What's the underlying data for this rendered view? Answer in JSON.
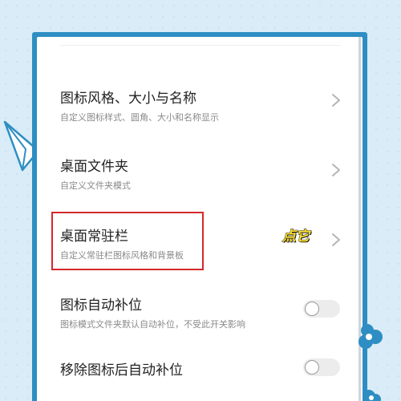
{
  "settings": {
    "items": [
      {
        "title": "图标风格、大小与名称",
        "subtitle": "自定义图标样式、圆角、大小和名称显示",
        "control": "chevron"
      },
      {
        "title": "桌面文件夹",
        "subtitle": "自定义文件夹模式",
        "control": "chevron"
      },
      {
        "title": "桌面常驻栏",
        "subtitle": "自定义常驻栏图标风格和背景板",
        "control": "chevron"
      },
      {
        "title": "图标自动补位",
        "subtitle": "图标模式文件夹默认自动补位，不受此开关影响",
        "control": "toggle",
        "toggle_on": false
      },
      {
        "title": "移除图标后自动补位",
        "subtitle": "",
        "control": "toggle",
        "toggle_on": false
      }
    ]
  },
  "annotation": {
    "label": "点它",
    "color": "#ffe22b"
  },
  "colors": {
    "frame": "#2e8ec3",
    "background": "#d9ecf8",
    "highlight_border": "#d3282b",
    "title_text": "#222222",
    "subtitle_text": "#8a8a8a"
  },
  "icons": [
    "paper-plane-icon",
    "cloud-icon",
    "chevron-right-icon"
  ]
}
